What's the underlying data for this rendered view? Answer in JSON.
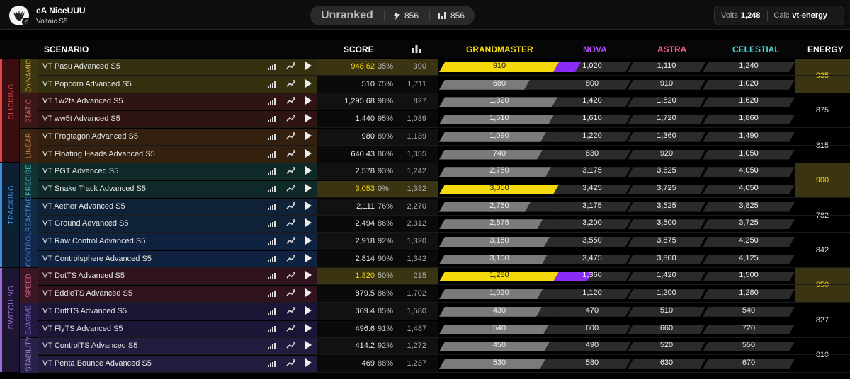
{
  "profile": {
    "name": "eA NiceUUU",
    "benchmark": "Voltaic S5"
  },
  "rank": {
    "label": "Unranked",
    "energy": "856",
    "stat": "856"
  },
  "volts": {
    "label": "Volts",
    "value": "1,248",
    "calc_label": "Calc",
    "calc_value": "vt-energy"
  },
  "headers": {
    "scenario": "SCENARIO",
    "score": "SCORE",
    "grandmaster": "GRANDMASTER",
    "nova": "NOVA",
    "astra": "ASTRA",
    "celestial": "CELESTIAL",
    "energy": "ENERGY"
  },
  "colors": {
    "grandmaster": "#f5d90a",
    "nova": "#b04ef5",
    "astra": "#f45a9b",
    "celestial": "#4fd3d3",
    "highlight": "#3b3413"
  },
  "groups": [
    {
      "label": "CLICKING",
      "color": "#e04848"
    },
    {
      "label": "TRACKING",
      "color": "#3f8ed8"
    },
    {
      "label": "SWITCHING",
      "color": "#9b6fd6"
    }
  ],
  "subgroups": [
    {
      "label": "DYNAMIC",
      "color": "#d6b53a",
      "energy": "935"
    },
    {
      "label": "STATIC",
      "color": "#d86a6a",
      "energy": "875"
    },
    {
      "label": "LINEAR",
      "color": "#d88a4a",
      "energy": "815"
    },
    {
      "label": "PRECISE",
      "color": "#4fc1c1",
      "energy": "900"
    },
    {
      "label": "REACTIVE",
      "color": "#4b8fd8",
      "energy": "782"
    },
    {
      "label": "CONTROL",
      "color": "#4b7fc8",
      "energy": "842"
    },
    {
      "label": "SPEED",
      "color": "#d66a8a",
      "energy": "950"
    },
    {
      "label": "EVASIVE",
      "color": "#8a6ad0",
      "energy": "827"
    },
    {
      "label": "STABILITY",
      "color": "#9a8ad0",
      "energy": "810"
    }
  ],
  "rows": [
    {
      "name": "VT Pasu Advanced S5",
      "score": "948.62",
      "pct": "35%",
      "played": "390",
      "gm": "910",
      "nova": "1,020",
      "astra": "1,110",
      "celestial": "1,240",
      "gm_fill": 1,
      "nova_fill": 0.35
    },
    {
      "name": "VT Popcorn Advanced S5",
      "score": "510",
      "pct": "75%",
      "played": "1,711",
      "gm": "680",
      "nova": "800",
      "astra": "910",
      "celestial": "1,020",
      "gm_fill": 0.75
    },
    {
      "name": "VT 1w2ts Advanced S5",
      "score": "1,295.68",
      "pct": "98%",
      "played": "827",
      "gm": "1,320",
      "nova": "1,420",
      "astra": "1,520",
      "celestial": "1,620",
      "gm_fill": 0.98
    },
    {
      "name": "VT ww5t Advanced S5",
      "score": "1,440",
      "pct": "95%",
      "played": "1,039",
      "gm": "1,510",
      "nova": "1,610",
      "astra": "1,720",
      "celestial": "1,860",
      "gm_fill": 0.95
    },
    {
      "name": "VT Frogtagon Advanced S5",
      "score": "980",
      "pct": "89%",
      "played": "1,139",
      "gm": "1,090",
      "nova": "1,220",
      "astra": "1,360",
      "celestial": "1,490",
      "gm_fill": 0.89
    },
    {
      "name": "VT Floating Heads Advanced S5",
      "score": "640.43",
      "pct": "86%",
      "played": "1,355",
      "gm": "740",
      "nova": "830",
      "astra": "920",
      "celestial": "1,050",
      "gm_fill": 0.86
    },
    {
      "name": "VT PGT Advanced S5",
      "score": "2,578",
      "pct": "93%",
      "played": "1,242",
      "gm": "2,750",
      "nova": "3,175",
      "astra": "3,625",
      "celestial": "4,050",
      "gm_fill": 0.93
    },
    {
      "name": "VT Snake Track Advanced S5",
      "score": "3,053",
      "pct": "0%",
      "played": "1,332",
      "gm": "3,050",
      "nova": "3,425",
      "astra": "3,725",
      "celestial": "4,050",
      "gm_fill": 1,
      "nova_fill": 0
    },
    {
      "name": "VT Aether Advanced S5",
      "score": "2,111",
      "pct": "76%",
      "played": "2,270",
      "gm": "2,750",
      "nova": "3,175",
      "astra": "3,525",
      "celestial": "3,825",
      "gm_fill": 0.76
    },
    {
      "name": "VT Ground Advanced S5",
      "score": "2,494",
      "pct": "86%",
      "played": "2,312",
      "gm": "2,875",
      "nova": "3,200",
      "astra": "3,500",
      "celestial": "3,725",
      "gm_fill": 0.86
    },
    {
      "name": "VT Raw Control Advanced S5",
      "score": "2,918",
      "pct": "92%",
      "played": "1,320",
      "gm": "3,150",
      "nova": "3,550",
      "astra": "3,875",
      "celestial": "4,250",
      "gm_fill": 0.92
    },
    {
      "name": "VT Controlsphere Advanced S5",
      "score": "2,814",
      "pct": "90%",
      "played": "1,342",
      "gm": "3,100",
      "nova": "3,475",
      "astra": "3,800",
      "celestial": "4,125",
      "gm_fill": 0.9
    },
    {
      "name": "VT DotTS Advanced S5",
      "score": "1,320",
      "pct": "50%",
      "played": "215",
      "gm": "1,280",
      "nova": "1,360",
      "astra": "1,420",
      "celestial": "1,500",
      "gm_fill": 1,
      "nova_fill": 0.5
    },
    {
      "name": "VT EddieTS Advanced S5",
      "score": "879.5",
      "pct": "86%",
      "played": "1,702",
      "gm": "1,020",
      "nova": "1,120",
      "astra": "1,200",
      "celestial": "1,280",
      "gm_fill": 0.86
    },
    {
      "name": "VT DriftTS Advanced S5",
      "score": "369.4",
      "pct": "85%",
      "played": "1,580",
      "gm": "430",
      "nova": "470",
      "astra": "510",
      "celestial": "540",
      "gm_fill": 0.85
    },
    {
      "name": "VT FlyTS Advanced S5",
      "score": "496.6",
      "pct": "91%",
      "played": "1,487",
      "gm": "540",
      "nova": "600",
      "astra": "660",
      "celestial": "720",
      "gm_fill": 0.91
    },
    {
      "name": "VT ControlTS Advanced S5",
      "score": "414.2",
      "pct": "92%",
      "played": "1,272",
      "gm": "450",
      "nova": "490",
      "astra": "520",
      "celestial": "550",
      "gm_fill": 0.92
    },
    {
      "name": "VT Penta Bounce Advanced S5",
      "score": "469",
      "pct": "88%",
      "played": "1,237",
      "gm": "530",
      "nova": "580",
      "astra": "630",
      "celestial": "670",
      "gm_fill": 0.88
    }
  ]
}
